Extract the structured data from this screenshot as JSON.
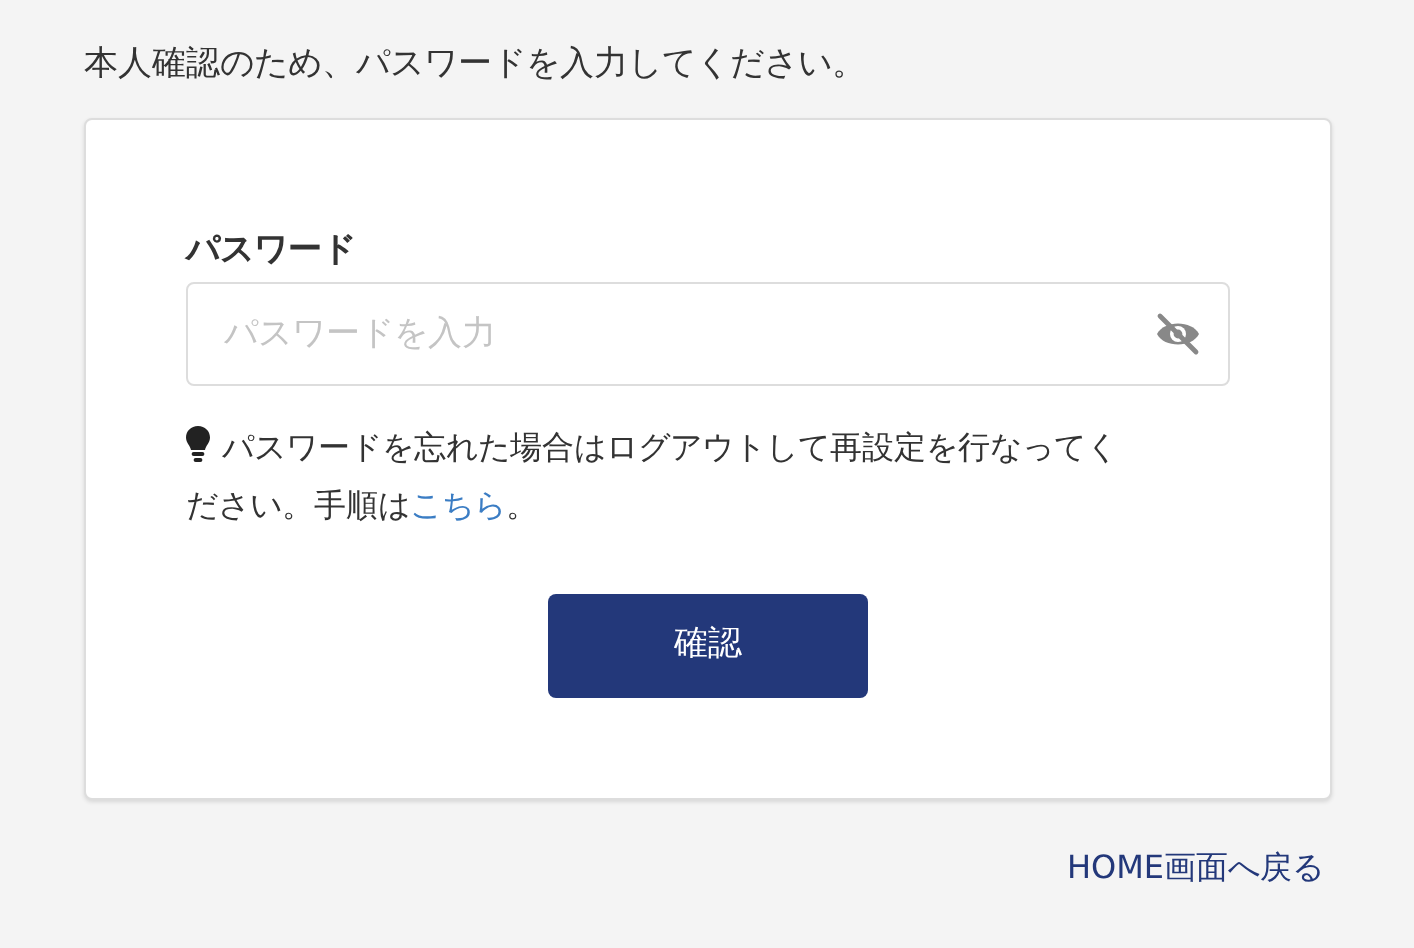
{
  "intro": "本人確認のため、パスワードを入力してください。",
  "password_field": {
    "label": "パスワード",
    "placeholder": "パスワードを入力",
    "password_visible": false
  },
  "hint": {
    "text": "パスワードを忘れた場合はログアウトして再設定を行なってください。手順は",
    "link": "こちら",
    "text_after": "。"
  },
  "confirm_button": "確認",
  "home_link": "HOME画面へ戻る"
}
